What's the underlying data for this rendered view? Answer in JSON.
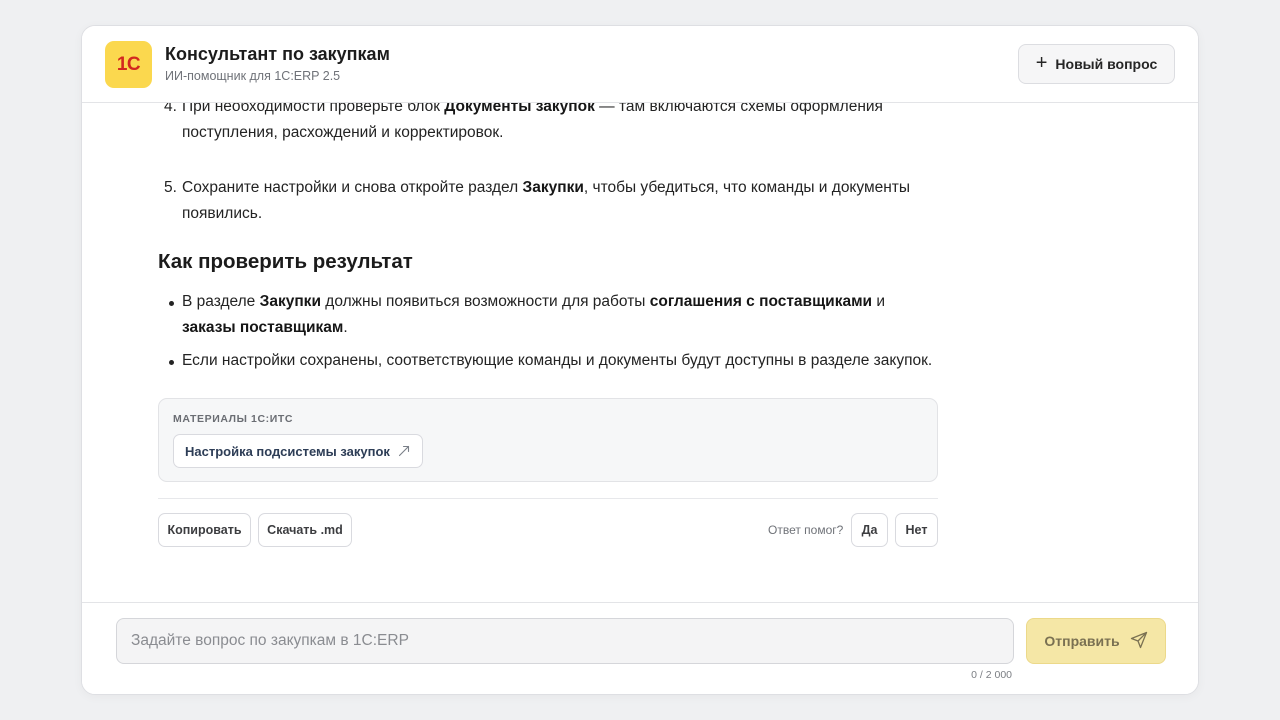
{
  "header": {
    "logo_text": "1С",
    "title": "Консультант по закупкам",
    "subtitle": "ИИ-помощник для 1С:ERP 2.5",
    "new_question_label": "Новый вопрос"
  },
  "answer": {
    "steps": [
      {
        "num": "4.",
        "parts": [
          {
            "t": "При необходимости проверьте блок "
          },
          {
            "t": "Документы закупок",
            "b": true
          },
          {
            "t": " — там включаются схемы оформления поступления, расхождений и корректировок."
          }
        ]
      },
      {
        "num": "5.",
        "parts": [
          {
            "t": "Сохраните настройки и снова откройте раздел "
          },
          {
            "t": "Закупки",
            "b": true
          },
          {
            "t": ", чтобы убедиться, что команды и документы появились."
          }
        ]
      }
    ],
    "check_heading": "Как проверить результат",
    "bullets": [
      {
        "parts": [
          {
            "t": "В разделе "
          },
          {
            "t": "Закупки",
            "b": true
          },
          {
            "t": " должны появиться возможности для работы "
          },
          {
            "t": "соглашения с поставщиками",
            "b": true
          },
          {
            "t": " и "
          },
          {
            "t": "заказы поставщикам",
            "b": true
          },
          {
            "t": "."
          }
        ]
      },
      {
        "parts": [
          {
            "t": "Если настройки сохранены, соответствующие команды и документы будут доступны в разделе закупок."
          }
        ]
      }
    ],
    "materials": {
      "label": "МАТЕРИАЛЫ 1С:ИТС",
      "link_label": "Настройка подсистемы закупок"
    },
    "actions": {
      "copy_label": "Копировать",
      "download_label": "Скачать .md",
      "helped_question": "Ответ помог?",
      "yes_label": "Да",
      "no_label": "Нет"
    }
  },
  "composer": {
    "placeholder": "Задайте вопрос по закупкам в 1С:ERP",
    "value": "",
    "send_label": "Отправить",
    "counter": "0 / 2 000"
  },
  "colors": {
    "logo_bg": "#fbd84e",
    "logo_text": "#d3281f",
    "send_bg": "#f5e7a6",
    "page_bg": "#eff0f2"
  }
}
